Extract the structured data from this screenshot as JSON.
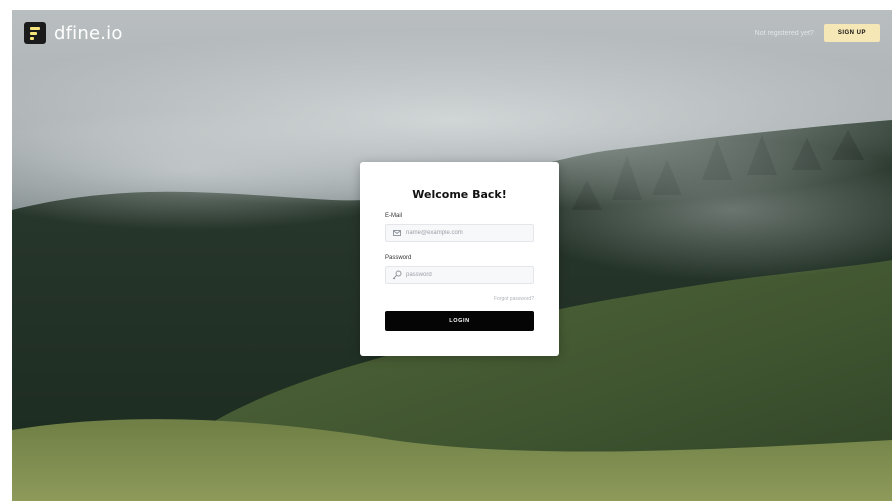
{
  "app": {
    "brand": "dfine.io"
  },
  "header": {
    "not_registered": "Not registered yet?",
    "signup_label": "SIGN UP"
  },
  "login": {
    "title": "Welcome Back!",
    "email_label": "E-Mail",
    "email_placeholder": "name@example.com",
    "password_label": "Password",
    "password_placeholder": "password",
    "forgot": "Forgot password?",
    "button": "LOGIN"
  },
  "icons": {
    "email": "envelope-icon",
    "password": "key-icon"
  },
  "colors": {
    "signup_bg": "#f6e7b6",
    "button_bg": "#050505",
    "card_bg": "#ffffff"
  }
}
